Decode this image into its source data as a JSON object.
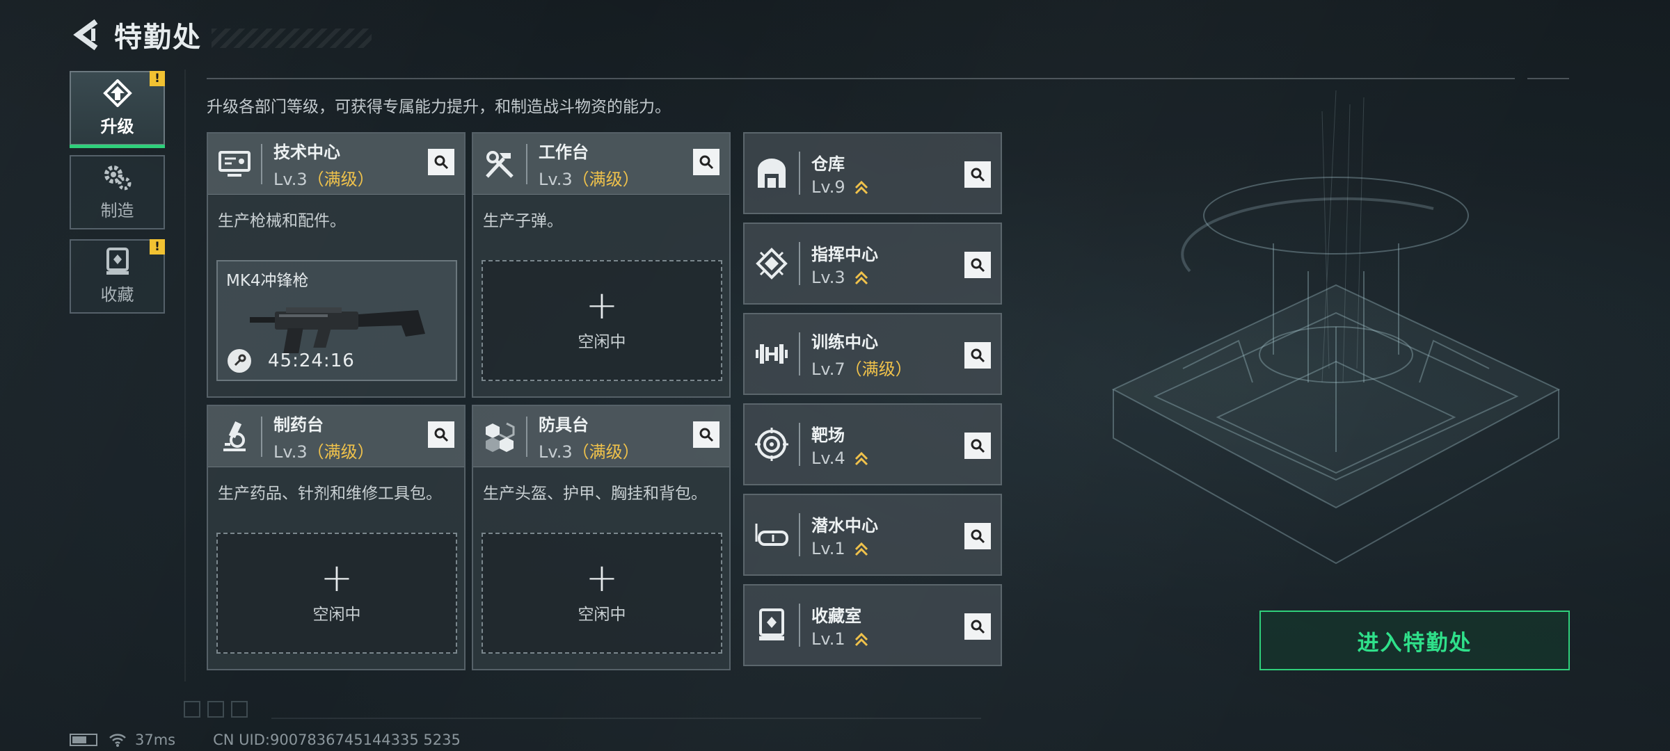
{
  "header": {
    "title": "特勤处"
  },
  "nav": [
    {
      "label": "升级",
      "icon": "upgrade-icon",
      "active": true,
      "badge": "!"
    },
    {
      "label": "制造",
      "icon": "gears-icon",
      "active": false,
      "badge": ""
    },
    {
      "label": "收藏",
      "icon": "collection-icon",
      "active": false,
      "badge": "!"
    }
  ],
  "description": "升级各部门等级，可获得专属能力提升，和制造战斗物资的能力。",
  "cards": [
    {
      "name": "技术中心",
      "level": "Lv.3",
      "max": "（满级）",
      "icon": "monitor-icon",
      "desc": "生产枪械和配件。",
      "slot": {
        "type": "item",
        "item_name": "MK4冲锋枪",
        "timer": "45:24:16",
        "timer_icon": "wrench-icon"
      }
    },
    {
      "name": "工作台",
      "level": "Lv.3",
      "max": "（满级）",
      "icon": "tools-icon",
      "desc": "生产子弹。",
      "slot": {
        "type": "empty",
        "label": "空闲中"
      }
    },
    {
      "name": "制药台",
      "level": "Lv.3",
      "max": "（满级）",
      "icon": "microscope-icon",
      "desc": "生产药品、针剂和维修工具包。",
      "slot": {
        "type": "empty",
        "label": "空闲中"
      }
    },
    {
      "name": "防具台",
      "level": "Lv.3",
      "max": "（满级）",
      "icon": "cubes-icon",
      "desc": "生产头盔、护甲、胸挂和背包。",
      "slot": {
        "type": "empty",
        "label": "空闲中"
      }
    }
  ],
  "small_cards": [
    {
      "name": "仓库",
      "level": "Lv.9",
      "max": "",
      "upgradable": true,
      "icon": "warehouse-icon"
    },
    {
      "name": "指挥中心",
      "level": "Lv.3",
      "max": "",
      "upgradable": true,
      "icon": "command-icon"
    },
    {
      "name": "训练中心",
      "level": "Lv.7",
      "max": "（满级）",
      "upgradable": false,
      "icon": "dumbbell-icon"
    },
    {
      "name": "靶场",
      "level": "Lv.4",
      "max": "",
      "upgradable": true,
      "icon": "target-icon"
    },
    {
      "name": "潜水中心",
      "level": "Lv.1",
      "max": "",
      "upgradable": true,
      "icon": "goggles-icon"
    },
    {
      "name": "收藏室",
      "level": "Lv.1",
      "max": "",
      "upgradable": true,
      "icon": "showcase-icon"
    }
  ],
  "enter_button": "进入特勤处",
  "footer": {
    "ping": "37ms",
    "uid": "CN UID:9007836745144335 5235"
  },
  "colors": {
    "accent_green": "#2fd07b",
    "max_gold": "#f0c24b",
    "badge_yellow": "#f2c232"
  }
}
